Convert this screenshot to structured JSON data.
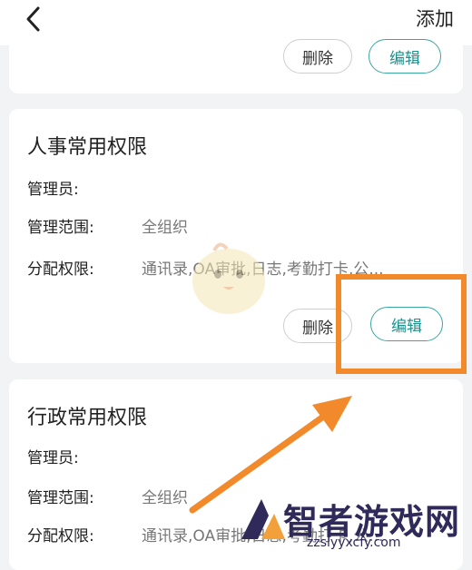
{
  "header": {
    "back_icon": "chevron-left-icon",
    "add_label": "添加"
  },
  "prev_card": {
    "delete_label": "删除",
    "edit_label": "编辑"
  },
  "cards": [
    {
      "title": "人事常用权限",
      "admin_label": "管理员:",
      "admin_value": "",
      "scope_label": "管理范围:",
      "scope_value": "全组织",
      "perm_label": "分配权限:",
      "perm_value": "通讯录,OA审批,日志,考勤打卡,公...",
      "delete_label": "删除",
      "edit_label": "编辑"
    },
    {
      "title": "行政常用权限",
      "admin_label": "管理员:",
      "admin_value": "",
      "scope_label": "管理范围:",
      "scope_value": "全组织",
      "perm_label": "分配权限:",
      "perm_value": "通讯录,OA审批,日志,考勤打卡,公..."
    }
  ],
  "annotation": {
    "highlight_color": "#f28a2c"
  },
  "watermark": {
    "name": "智者游戏网",
    "url": "zzslyyxcfy.com"
  },
  "colors": {
    "accent": "#3aa7a3",
    "background": "#f2f3f5"
  }
}
